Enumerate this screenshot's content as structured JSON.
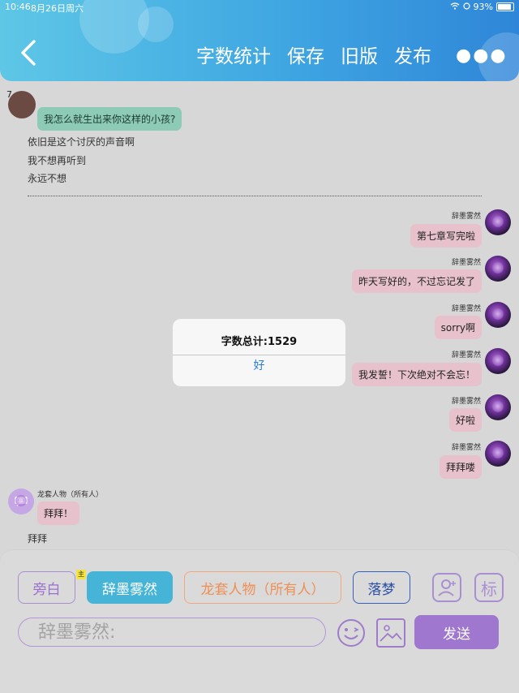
{
  "status_bar": {
    "time": "10:46",
    "date": "8月26日周六",
    "battery": "93%"
  },
  "header": {
    "actions": [
      "字数统计",
      "保存",
      "旧版",
      "发布"
    ]
  },
  "chat": {
    "counter": "7",
    "first_bubble": "我怎么就生出来你这样的小孩?",
    "narration": [
      "依旧是这个讨厌的声音啊",
      "我不想再听到",
      "永远不想"
    ],
    "right_messages": [
      {
        "name": "辞墨雾然",
        "text": "第七章写完啦"
      },
      {
        "name": "辞墨雾然",
        "text": "昨天写好的，不过忘记发了"
      },
      {
        "name": "辞墨雾然",
        "text": "sorry啊"
      },
      {
        "name": "辞墨雾然",
        "text": "我发誓！下次绝对不会忘！"
      },
      {
        "name": "辞墨雾然",
        "text": "好啦"
      },
      {
        "name": "辞墨雾然",
        "text": "拜拜喽"
      }
    ],
    "left_message": {
      "name": "龙套人物（所有人）",
      "text": "拜拜！"
    },
    "final_narration": "拜拜"
  },
  "modal": {
    "message": "字数总计:1529",
    "ok_label": "好"
  },
  "role_bar": {
    "aside": "旁白",
    "main_badge": "主",
    "main_role": "辞墨雾然",
    "group_role": "龙套人物（所有人）",
    "dream_role": "落梦",
    "tag_icon_label": "标"
  },
  "composer": {
    "placeholder": "辞墨雾然:",
    "send_label": "发送"
  },
  "colors": {
    "header_start": "#5ec7e6",
    "header_end": "#2f86d8",
    "send": "#a077cf",
    "main_chip": "#45b4d6",
    "pink_bubble": "#e7c2cd",
    "green_bubble": "#8ecbb6"
  }
}
